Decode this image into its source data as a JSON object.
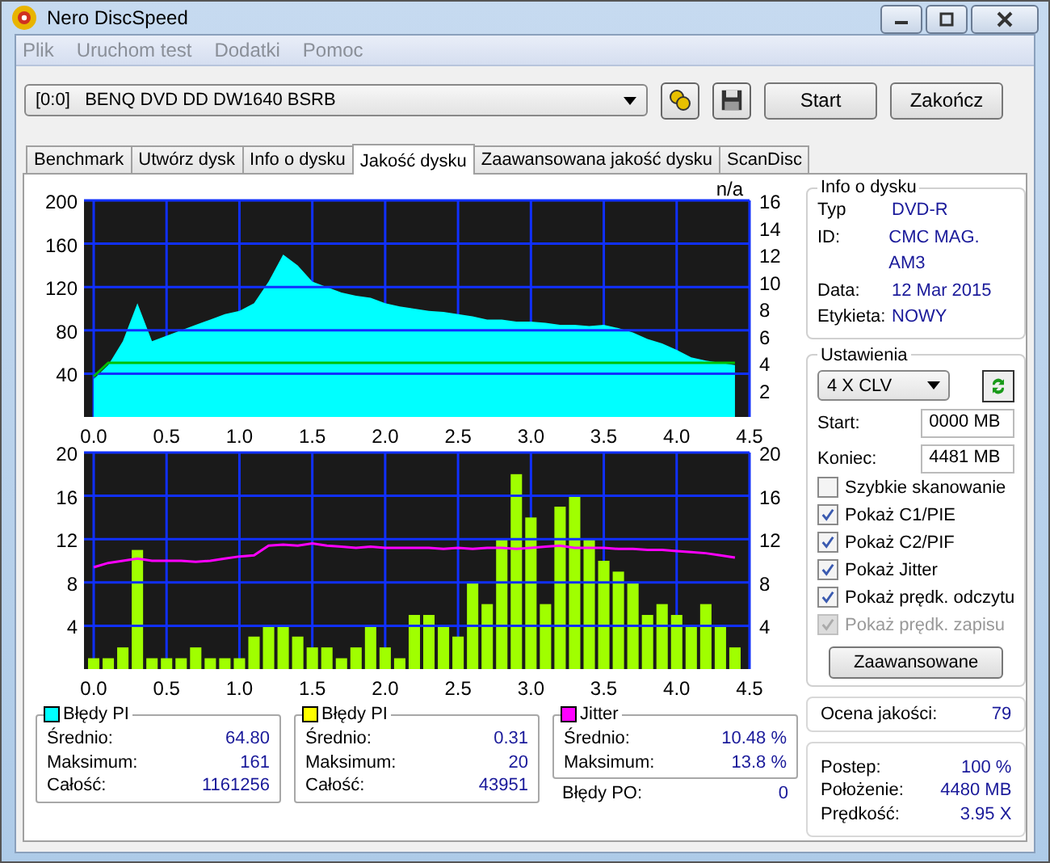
{
  "window": {
    "title": "Nero DiscSpeed"
  },
  "menu": [
    {
      "label": "Plik"
    },
    {
      "label": "Uruchom test"
    },
    {
      "label": "Dodatki"
    },
    {
      "label": "Pomoc"
    }
  ],
  "toolbar": {
    "drive": "[0:0]   BENQ DVD DD DW1640 BSRB",
    "start": "Start",
    "exit": "Zakończ"
  },
  "tabs": [
    {
      "label": "Benchmark",
      "selected": false
    },
    {
      "label": "Utwórz dysk",
      "selected": false
    },
    {
      "label": "Info o dysku",
      "selected": false
    },
    {
      "label": "Jakość dysku",
      "selected": true
    },
    {
      "label": "Zaawansowana jakość dysku",
      "selected": false
    },
    {
      "label": "ScanDisc",
      "selected": false
    }
  ],
  "charts": [
    {
      "corner_label": "n/a",
      "chart_data": {
        "type": "area",
        "grid": true,
        "xlim": [
          0,
          4.5
        ],
        "ylim": [
          0,
          200
        ],
        "xticks": [
          {
            "value": 0,
            "label": "0.0"
          },
          {
            "value": 0.5,
            "label": "0.5"
          },
          {
            "value": 1,
            "label": "1.0"
          },
          {
            "value": 1.5,
            "label": "1.5"
          },
          {
            "value": 2,
            "label": "2.0"
          },
          {
            "value": 2.5,
            "label": "2.5"
          },
          {
            "value": 3,
            "label": "3.0"
          },
          {
            "value": 3.5,
            "label": "3.5"
          },
          {
            "value": 4,
            "label": "4.0"
          },
          {
            "value": 4.5,
            "label": "4.5"
          }
        ],
        "yticks": [
          40,
          80,
          120,
          160,
          200
        ],
        "y2lim": [
          0,
          16
        ],
        "y2ticks": [
          2,
          4,
          6,
          8,
          10,
          12,
          14,
          16
        ],
        "x": [
          0,
          0.1,
          0.2,
          0.3,
          0.4,
          0.5,
          0.6,
          0.7,
          0.8,
          0.9,
          1,
          1.1,
          1.2,
          1.3,
          1.4,
          1.5,
          1.6,
          1.7,
          1.8,
          1.9,
          2,
          2.1,
          2.2,
          2.3,
          2.4,
          2.5,
          2.6,
          2.7,
          2.8,
          2.9,
          3,
          3.1,
          3.2,
          3.3,
          3.4,
          3.5,
          3.6,
          3.7,
          3.8,
          3.9,
          4,
          4.1,
          4.2,
          4.3,
          4.4
        ],
        "series": [
          {
            "color": "#00ffff",
            "values": [
              35,
              48,
              70,
              105,
              70,
              75,
              80,
              85,
              90,
              95,
              98,
              105,
              125,
              150,
              140,
              125,
              120,
              115,
              112,
              110,
              105,
              102,
              100,
              98,
              97,
              95,
              93,
              90,
              90,
              88,
              88,
              87,
              85,
              85,
              84,
              85,
              82,
              78,
              72,
              68,
              62,
              55,
              52,
              50,
              48
            ]
          },
          {
            "type": "line",
            "color": "#00c000",
            "axis": "y2",
            "values": [
              3,
              4,
              4,
              4,
              4,
              4,
              4,
              4,
              4,
              4,
              4,
              4,
              4,
              4,
              4,
              4,
              4,
              4,
              4,
              4,
              4,
              4,
              4,
              4,
              4,
              4,
              4,
              4,
              4,
              4,
              4,
              4,
              4,
              4,
              4,
              4,
              4,
              4,
              4,
              4,
              4,
              4,
              4,
              4,
              4
            ]
          }
        ]
      }
    },
    {
      "chart_data": {
        "type": "bar",
        "grid": true,
        "xlim": [
          0,
          4.5
        ],
        "ylim": [
          0,
          20
        ],
        "xticks": [
          {
            "value": 0,
            "label": "0.0"
          },
          {
            "value": 0.5,
            "label": "0.5"
          },
          {
            "value": 1,
            "label": "1.0"
          },
          {
            "value": 1.5,
            "label": "1.5"
          },
          {
            "value": 2,
            "label": "2.0"
          },
          {
            "value": 2.5,
            "label": "2.5"
          },
          {
            "value": 3,
            "label": "3.0"
          },
          {
            "value": 3.5,
            "label": "3.5"
          },
          {
            "value": 4,
            "label": "4.0"
          },
          {
            "value": 4.5,
            "label": "4.5"
          }
        ],
        "yticks": [
          4,
          8,
          12,
          16,
          20
        ],
        "y2lim": [
          0,
          20
        ],
        "y2ticks": [
          4,
          8,
          12,
          16,
          20
        ],
        "x": [
          0,
          0.1,
          0.2,
          0.3,
          0.4,
          0.5,
          0.6,
          0.7,
          0.8,
          0.9,
          1,
          1.1,
          1.2,
          1.3,
          1.4,
          1.5,
          1.6,
          1.7,
          1.8,
          1.9,
          2,
          2.1,
          2.2,
          2.3,
          2.4,
          2.5,
          2.6,
          2.7,
          2.8,
          2.9,
          3,
          3.1,
          3.2,
          3.3,
          3.4,
          3.5,
          3.6,
          3.7,
          3.8,
          3.9,
          4,
          4.1,
          4.2,
          4.3,
          4.4
        ],
        "series": [
          {
            "color": "#a0ff00",
            "values": [
              1,
              1,
              2,
              11,
              1,
              1,
              1,
              2,
              1,
              1,
              1,
              3,
              4,
              4,
              3,
              2,
              2,
              1,
              2,
              4,
              2,
              1,
              5,
              5,
              4,
              3,
              8,
              6,
              12,
              18,
              14,
              6,
              15,
              16,
              12,
              10,
              9,
              8,
              5,
              6,
              5,
              4,
              6,
              4,
              2
            ]
          },
          {
            "type": "line",
            "color": "#ff00ff",
            "axis": "y2",
            "values": [
              9.4,
              9.8,
              10,
              10.2,
              10,
              10,
              10,
              9.9,
              10,
              10.2,
              10.4,
              10.5,
              11.4,
              11.5,
              11.4,
              11.6,
              11.4,
              11.3,
              11.2,
              11.3,
              11.2,
              11.2,
              11.2,
              11.2,
              11.1,
              11.2,
              11.1,
              11.2,
              11.2,
              11.1,
              11.2,
              11.3,
              11.4,
              11.2,
              11.2,
              11.2,
              11.1,
              11.1,
              11,
              11,
              10.9,
              10.8,
              10.7,
              10.5,
              10.3
            ]
          }
        ]
      }
    }
  ],
  "stats": [
    {
      "title": "Błędy PI",
      "color": "#00ffff",
      "rows": [
        {
          "label": "Średnio:",
          "value": "64.80"
        },
        {
          "label": "Maksimum:",
          "value": "161"
        },
        {
          "label": "Całość:",
          "value": "1161256"
        }
      ]
    },
    {
      "title": "Błędy PI",
      "color": "#ffff00",
      "rows": [
        {
          "label": "Średnio:",
          "value": "0.31"
        },
        {
          "label": "Maksimum:",
          "value": "20"
        },
        {
          "label": "Całość:",
          "value": "43951"
        }
      ]
    },
    {
      "title": "Jitter",
      "color": "#ff00ff",
      "rows": [
        {
          "label": "Średnio:",
          "value": "10.48 %"
        },
        {
          "label": "Maksimum:",
          "value": "13.8 %"
        }
      ]
    }
  ],
  "po_errors": {
    "label": "Błędy PO:",
    "value": "0"
  },
  "disc_info": {
    "title": "Info o dysku",
    "rows": [
      {
        "label": "Typ",
        "value": "DVD-R"
      },
      {
        "label": "ID:",
        "value": "CMC MAG. AM3"
      },
      {
        "label": "Data:",
        "value": "12 Mar 2015"
      },
      {
        "label": "Etykieta:",
        "value": "NOWY"
      }
    ]
  },
  "settings": {
    "title": "Ustawienia",
    "speed": "4 X CLV",
    "start_label": "Start:",
    "start": "0000 MB",
    "end_label": "Koniec:",
    "end": "4481 MB",
    "options": [
      {
        "label": "Szybkie skanowanie",
        "checked": false,
        "disabled": false
      },
      {
        "label": "Pokaż C1/PIE",
        "checked": true,
        "disabled": false
      },
      {
        "label": "Pokaż C2/PIF",
        "checked": true,
        "disabled": false
      },
      {
        "label": "Pokaż Jitter",
        "checked": true,
        "disabled": false
      },
      {
        "label": "Pokaż prędk. odczytu",
        "checked": true,
        "disabled": false
      },
      {
        "label": "Pokaż prędk. zapisu",
        "checked": true,
        "disabled": true
      }
    ],
    "advanced": "Zaawansowane"
  },
  "quality": {
    "label": "Ocena jakości:",
    "value": "79"
  },
  "progress": [
    {
      "label": "Postep:",
      "value": "100 %"
    },
    {
      "label": "Położenie:",
      "value": "4480 MB"
    },
    {
      "label": "Prędkość:",
      "value": "3.95 X"
    }
  ]
}
